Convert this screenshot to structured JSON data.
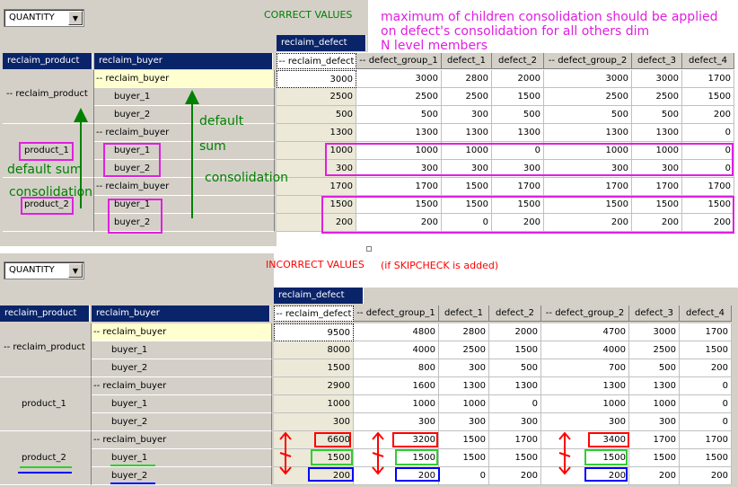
{
  "dropdown_value": "QUANTITY",
  "header": {
    "page_dim": "reclaim_defect",
    "row_dims": [
      "reclaim_product",
      "reclaim_buyer"
    ],
    "columns": [
      "-- reclaim_defect",
      "-- defect_group_1",
      "defect_1",
      "defect_2",
      "-- defect_group_2",
      "defect_3",
      "defect_4"
    ]
  },
  "top": {
    "title": "CORRECT VALUES",
    "note_lines": [
      "maximum of children consolidation should be applied",
      "on defect's consolidation for all others dim",
      "N level members"
    ],
    "annotations": {
      "default_sum": "default sum",
      "consolidation": "consolidation",
      "default": "default",
      "sum": "sum",
      "consolidation2": "consolidation"
    },
    "product_labels": [
      "-- reclaim_product",
      "product_1",
      "product_2"
    ],
    "buyer_labels": [
      "-- reclaim_buyer",
      "buyer_1",
      "buyer_2",
      "-- reclaim_buyer",
      "buyer_1",
      "buyer_2",
      "-- reclaim_buyer",
      "buyer_1",
      "buyer_2"
    ],
    "rows": [
      [
        "3000",
        "3000",
        "2800",
        "2000",
        "3000",
        "3000",
        "1700"
      ],
      [
        "2500",
        "2500",
        "2500",
        "1500",
        "2500",
        "2500",
        "1500"
      ],
      [
        "500",
        "500",
        "300",
        "500",
        "500",
        "500",
        "200"
      ],
      [
        "1300",
        "1300",
        "1300",
        "1300",
        "1300",
        "1300",
        "0"
      ],
      [
        "1000",
        "1000",
        "1000",
        "0",
        "1000",
        "1000",
        "0"
      ],
      [
        "300",
        "300",
        "300",
        "300",
        "300",
        "300",
        "0"
      ],
      [
        "1700",
        "1700",
        "1500",
        "1700",
        "1700",
        "1700",
        "1700"
      ],
      [
        "1500",
        "1500",
        "1500",
        "1500",
        "1500",
        "1500",
        "1500"
      ],
      [
        "200",
        "200",
        "0",
        "200",
        "200",
        "200",
        "200"
      ]
    ]
  },
  "bottom": {
    "title": "INCORRECT VALUES",
    "subtitle": "(if SKIPCHECK is added)",
    "product_labels": [
      "-- reclaim_product",
      "product_1",
      "product_2"
    ],
    "buyer_labels": [
      "-- reclaim_buyer",
      "buyer_1",
      "buyer_2",
      "-- reclaim_buyer",
      "buyer_1",
      "buyer_2",
      "-- reclaim_buyer",
      "buyer_1",
      "buyer_2"
    ],
    "rows": [
      [
        "9500",
        "4800",
        "2800",
        "2000",
        "4700",
        "3000",
        "1700"
      ],
      [
        "8000",
        "4000",
        "2500",
        "1500",
        "4000",
        "2500",
        "1500"
      ],
      [
        "1500",
        "800",
        "300",
        "500",
        "700",
        "500",
        "200"
      ],
      [
        "2900",
        "1600",
        "1300",
        "1300",
        "1300",
        "1300",
        "0"
      ],
      [
        "1000",
        "1000",
        "1000",
        "0",
        "1000",
        "1000",
        "0"
      ],
      [
        "300",
        "300",
        "300",
        "300",
        "300",
        "300",
        "0"
      ],
      [
        "6600",
        "3200",
        "1500",
        "1700",
        "3400",
        "1700",
        "1700"
      ],
      [
        "1500",
        "1500",
        "1500",
        "1500",
        "1500",
        "1500",
        "1500"
      ],
      [
        "200",
        "200",
        "0",
        "200",
        "200",
        "200",
        "200"
      ]
    ]
  },
  "colors": {
    "navy": "#0a246a",
    "green_text": "#008000",
    "magenta": "#e020e0",
    "red": "#ff0000",
    "blue": "#0000ff",
    "green_box": "#33cc33"
  }
}
